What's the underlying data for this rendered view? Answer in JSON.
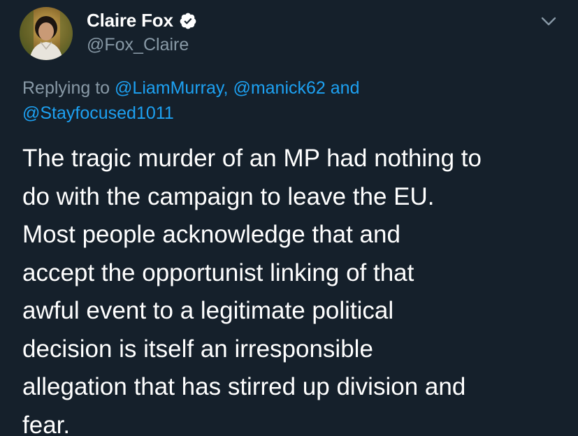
{
  "user": {
    "display_name": "Claire Fox",
    "handle": "@Fox_Claire",
    "verified": true
  },
  "reply_context": {
    "prefix": "Replying to ",
    "mentions": [
      "@LiamMurray",
      "@manick62",
      "@Stayfocused1011"
    ],
    "sep_comma": ", ",
    "sep_and": " and"
  },
  "tweet": {
    "lines": [
      "The tragic murder of an MP had nothing to",
      "do with the campaign to leave the EU.",
      "Most people acknowledge that and",
      "accept the opportunist linking of that",
      "awful event to a legitimate political",
      "decision is itself an irresponsible",
      "allegation that has stirred up division and",
      "fear."
    ]
  },
  "icons": {
    "verified": "verified-badge-icon",
    "caret": "chevron-down-icon"
  },
  "colors": {
    "background": "#15202b",
    "text": "#ffffff",
    "secondary": "#8899a6",
    "link": "#1da1f2"
  }
}
